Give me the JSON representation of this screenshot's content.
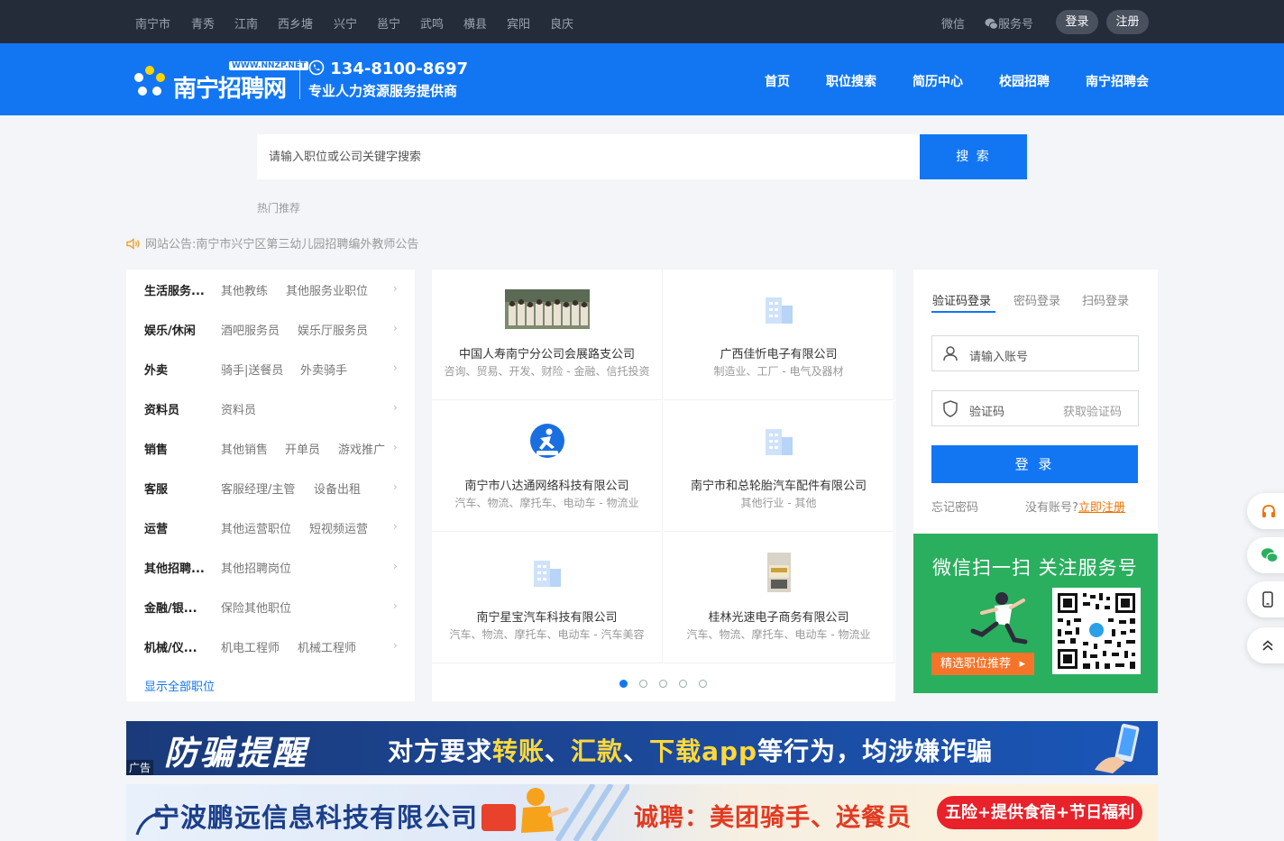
{
  "topbar": {
    "cities": [
      "南宁市",
      "青秀",
      "江南",
      "西乡塘",
      "兴宁",
      "邕宁",
      "武鸣",
      "横县",
      "宾阳",
      "良庆"
    ],
    "wechat": "微信",
    "service": "服务号",
    "login": "登录",
    "register": "注册"
  },
  "header": {
    "logo_text": "南宁招聘网",
    "logo_url": "WWW.NNZP.NET",
    "phone": "134-8100-8697",
    "slogan": "专业人力资源服务提供商",
    "nav": [
      "首页",
      "职位搜索",
      "简历中心",
      "校园招聘",
      "南宁招聘会"
    ]
  },
  "search": {
    "placeholder": "请输入职位或公司关键字搜索",
    "button": "搜 索",
    "hot_label": "热门推荐"
  },
  "notice": {
    "label": "网站公告:",
    "text": "南宁市兴宁区第三幼儿园招聘编外教师公告"
  },
  "categories": [
    {
      "title": "生活服务...",
      "subs": [
        "其他教练",
        "其他服务业职位"
      ]
    },
    {
      "title": "娱乐/休闲",
      "subs": [
        "酒吧服务员",
        "娱乐厅服务员"
      ]
    },
    {
      "title": "外卖",
      "subs": [
        "骑手|送餐员",
        "外卖骑手"
      ]
    },
    {
      "title": "资料员",
      "subs": [
        "资料员"
      ]
    },
    {
      "title": "销售",
      "subs": [
        "其他销售",
        "开单员",
        "游戏推广"
      ]
    },
    {
      "title": "客服",
      "subs": [
        "客服经理/主管",
        "设备出租"
      ]
    },
    {
      "title": "运营",
      "subs": [
        "其他运营职位",
        "短视频运营"
      ]
    },
    {
      "title": "其他招聘...",
      "subs": [
        "其他招聘岗位"
      ]
    },
    {
      "title": "金融/银...",
      "subs": [
        "保险其他职位"
      ]
    },
    {
      "title": "机械/仪...",
      "subs": [
        "机电工程师",
        "机械工程师"
      ]
    }
  ],
  "categories_all": "显示全部职位",
  "companies": [
    {
      "name": "中国人寿南宁分公司会展路支公司",
      "industry": "咨询、贸易、开发、财险 - 金融、信托投资",
      "logo": "group-photo"
    },
    {
      "name": "广西佳忻电子有限公司",
      "industry": "制造业、工厂 - 电气及器材",
      "logo": "building-icon"
    },
    {
      "name": "南宁市八达通网络科技有限公司",
      "industry": "汽车、物流、摩托车、电动车 - 物流业",
      "logo": "delivery-logo"
    },
    {
      "name": "南宁市和总轮胎汽车配件有限公司",
      "industry": "其他行业 - 其他",
      "logo": "building-icon"
    },
    {
      "name": "南宁星宝汽车科技有限公司",
      "industry": "汽车、物流、摩托车、电动车 - 汽车美容",
      "logo": "building-icon"
    },
    {
      "name": "桂林光速电子商务有限公司",
      "industry": "汽车、物流、摩托车、电动车 - 物流业",
      "logo": "shop-photo"
    }
  ],
  "carousel": {
    "pages": 5,
    "active": 1
  },
  "login": {
    "tabs": [
      "验证码登录",
      "密码登录",
      "扫码登录"
    ],
    "account_placeholder": "请输入账号",
    "code_placeholder": "验证码",
    "get_code": "获取验证码",
    "button": "登 录",
    "forgot": "忘记密码",
    "no_account": "没有账号?",
    "register_now": "立即注册"
  },
  "wechat_banner": {
    "title": "微信扫一扫 关注服务号",
    "button": "精选职位推荐"
  },
  "side_tools": [
    "headset-icon",
    "wechat-icon",
    "mobile-icon",
    "back-to-top-icon"
  ],
  "ads": [
    {
      "title": "防骗提醒",
      "message_parts": [
        "对方要求",
        "转账",
        "、",
        "汇款",
        "、",
        "下载app",
        "等行为，均涉嫌诈骗"
      ],
      "label": "广告"
    },
    {
      "company": "宁波鹏远信息科技有限公司",
      "job": "诚聘：美团骑手、送餐员",
      "perk": "五险+提供食宿+节日福利"
    }
  ],
  "colors": {
    "brand": "#1276f3",
    "topbar": "#252c39",
    "wechat_green": "#2aaf5f",
    "accent_orange": "#f07300"
  }
}
